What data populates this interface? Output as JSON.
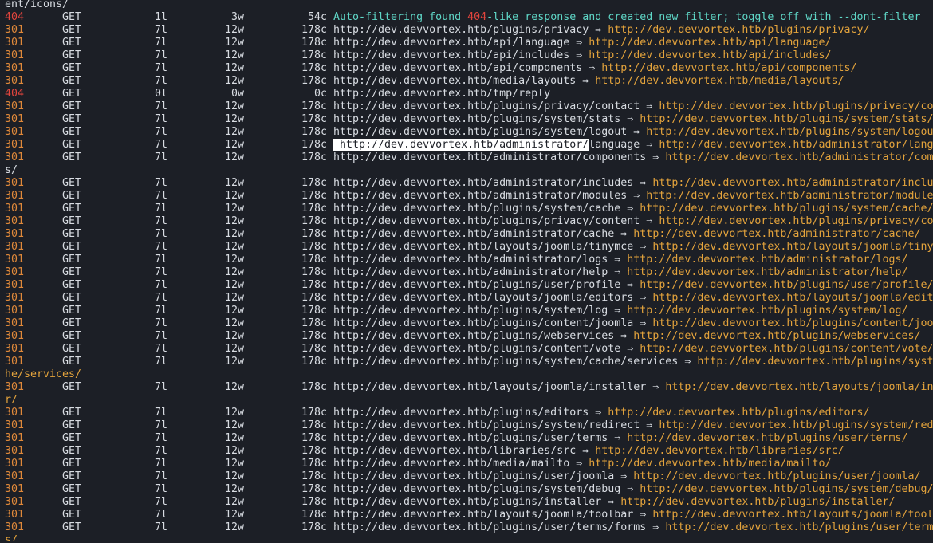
{
  "terminal": {
    "arrow": "⇒",
    "lines": [
      {
        "wrap": "ent/icons/"
      },
      {
        "status": "404",
        "method": "GET",
        "lines": "1l",
        "words": "3w",
        "chars": "54c",
        "msg1": "Auto-filtering found ",
        "msg2": "404",
        "msg3": "-like response and created new filter; toggle off with ",
        "msg4": "--dont-filter"
      },
      {
        "status": "301",
        "method": "GET",
        "lines": "7l",
        "words": "12w",
        "chars": "178c",
        "url": "http://dev.devvortex.htb/plugins/privacy",
        "redirect": "http://dev.devvortex.htb/plugins/privacy/"
      },
      {
        "status": "301",
        "method": "GET",
        "lines": "7l",
        "words": "12w",
        "chars": "178c",
        "url": "http://dev.devvortex.htb/api/language",
        "redirect": "http://dev.devvortex.htb/api/language/"
      },
      {
        "status": "301",
        "method": "GET",
        "lines": "7l",
        "words": "12w",
        "chars": "178c",
        "url": "http://dev.devvortex.htb/api/includes",
        "redirect": "http://dev.devvortex.htb/api/includes/"
      },
      {
        "status": "301",
        "method": "GET",
        "lines": "7l",
        "words": "12w",
        "chars": "178c",
        "url": "http://dev.devvortex.htb/api/components",
        "redirect": "http://dev.devvortex.htb/api/components/"
      },
      {
        "status": "301",
        "method": "GET",
        "lines": "7l",
        "words": "12w",
        "chars": "178c",
        "url": "http://dev.devvortex.htb/media/layouts",
        "redirect": "http://dev.devvortex.htb/media/layouts/"
      },
      {
        "status": "404",
        "method": "GET",
        "lines": "0l",
        "words": "0w",
        "chars": "0c",
        "url": "http://dev.devvortex.htb/tmp/reply"
      },
      {
        "status": "301",
        "method": "GET",
        "lines": "7l",
        "words": "12w",
        "chars": "178c",
        "url": "http://dev.devvortex.htb/plugins/privacy/contact",
        "redirect": "http://dev.devvortex.htb/plugins/privacy/contact/"
      },
      {
        "status": "301",
        "method": "GET",
        "lines": "7l",
        "words": "12w",
        "chars": "178c",
        "url": "http://dev.devvortex.htb/plugins/system/stats",
        "redirect": "http://dev.devvortex.htb/plugins/system/stats/"
      },
      {
        "status": "301",
        "method": "GET",
        "lines": "7l",
        "words": "12w",
        "chars": "178c",
        "url": "http://dev.devvortex.htb/plugins/system/logout",
        "redirect": "http://dev.devvortex.htb/plugins/system/logout/"
      },
      {
        "status": "301",
        "method": "GET",
        "lines": "7l",
        "words": "12w",
        "chars": "178c",
        "url_hl": " http://dev.devvortex.htb/administrator/",
        "url_rest": "language",
        "redirect": "http://dev.devvortex.htb/administrator/language/"
      },
      {
        "status": "301",
        "method": "GET",
        "lines": "7l",
        "words": "12w",
        "chars": "178c",
        "url": "http://dev.devvortex.htb/administrator/components",
        "redirect": "http://dev.devvortex.htb/administrator/component"
      },
      {
        "wrap": "s/"
      },
      {
        "status": "301",
        "method": "GET",
        "lines": "7l",
        "words": "12w",
        "chars": "178c",
        "url": "http://dev.devvortex.htb/administrator/includes",
        "redirect": "http://dev.devvortex.htb/administrator/includes/"
      },
      {
        "status": "301",
        "method": "GET",
        "lines": "7l",
        "words": "12w",
        "chars": "178c",
        "url": "http://dev.devvortex.htb/administrator/modules",
        "redirect": "http://dev.devvortex.htb/administrator/modules/"
      },
      {
        "status": "301",
        "method": "GET",
        "lines": "7l",
        "words": "12w",
        "chars": "178c",
        "url": "http://dev.devvortex.htb/plugins/system/cache",
        "redirect": "http://dev.devvortex.htb/plugins/system/cache/"
      },
      {
        "status": "301",
        "method": "GET",
        "lines": "7l",
        "words": "12w",
        "chars": "178c",
        "url": "http://dev.devvortex.htb/plugins/privacy/content",
        "redirect": "http://dev.devvortex.htb/plugins/privacy/content/"
      },
      {
        "status": "301",
        "method": "GET",
        "lines": "7l",
        "words": "12w",
        "chars": "178c",
        "url": "http://dev.devvortex.htb/administrator/cache",
        "redirect": "http://dev.devvortex.htb/administrator/cache/"
      },
      {
        "status": "301",
        "method": "GET",
        "lines": "7l",
        "words": "12w",
        "chars": "178c",
        "url": "http://dev.devvortex.htb/layouts/joomla/tinymce",
        "redirect": "http://dev.devvortex.htb/layouts/joomla/tinymce/"
      },
      {
        "status": "301",
        "method": "GET",
        "lines": "7l",
        "words": "12w",
        "chars": "178c",
        "url": "http://dev.devvortex.htb/administrator/logs",
        "redirect": "http://dev.devvortex.htb/administrator/logs/"
      },
      {
        "status": "301",
        "method": "GET",
        "lines": "7l",
        "words": "12w",
        "chars": "178c",
        "url": "http://dev.devvortex.htb/administrator/help",
        "redirect": "http://dev.devvortex.htb/administrator/help/"
      },
      {
        "status": "301",
        "method": "GET",
        "lines": "7l",
        "words": "12w",
        "chars": "178c",
        "url": "http://dev.devvortex.htb/plugins/user/profile",
        "redirect": "http://dev.devvortex.htb/plugins/user/profile/"
      },
      {
        "status": "301",
        "method": "GET",
        "lines": "7l",
        "words": "12w",
        "chars": "178c",
        "url": "http://dev.devvortex.htb/layouts/joomla/editors",
        "redirect": "http://dev.devvortex.htb/layouts/joomla/editors/"
      },
      {
        "status": "301",
        "method": "GET",
        "lines": "7l",
        "words": "12w",
        "chars": "178c",
        "url": "http://dev.devvortex.htb/plugins/system/log",
        "redirect": "http://dev.devvortex.htb/plugins/system/log/"
      },
      {
        "status": "301",
        "method": "GET",
        "lines": "7l",
        "words": "12w",
        "chars": "178c",
        "url": "http://dev.devvortex.htb/plugins/content/joomla",
        "redirect": "http://dev.devvortex.htb/plugins/content/joomla/"
      },
      {
        "status": "301",
        "method": "GET",
        "lines": "7l",
        "words": "12w",
        "chars": "178c",
        "url": "http://dev.devvortex.htb/plugins/webservices",
        "redirect": "http://dev.devvortex.htb/plugins/webservices/"
      },
      {
        "status": "301",
        "method": "GET",
        "lines": "7l",
        "words": "12w",
        "chars": "178c",
        "url": "http://dev.devvortex.htb/plugins/content/vote",
        "redirect": "http://dev.devvortex.htb/plugins/content/vote/"
      },
      {
        "status": "301",
        "method": "GET",
        "lines": "7l",
        "words": "12w",
        "chars": "178c",
        "url": "http://dev.devvortex.htb/plugins/system/cache/services",
        "redirect": "http://dev.devvortex.htb/plugins/system/cac"
      },
      {
        "wrap_url": "he/services/"
      },
      {
        "status": "301",
        "method": "GET",
        "lines": "7l",
        "words": "12w",
        "chars": "178c",
        "url": "http://dev.devvortex.htb/layouts/joomla/installer",
        "redirect": "http://dev.devvortex.htb/layouts/joomla/installe"
      },
      {
        "wrap_url": "r/"
      },
      {
        "status": "301",
        "method": "GET",
        "lines": "7l",
        "words": "12w",
        "chars": "178c",
        "url": "http://dev.devvortex.htb/plugins/editors",
        "redirect": "http://dev.devvortex.htb/plugins/editors/"
      },
      {
        "status": "301",
        "method": "GET",
        "lines": "7l",
        "words": "12w",
        "chars": "178c",
        "url": "http://dev.devvortex.htb/plugins/system/redirect",
        "redirect": "http://dev.devvortex.htb/plugins/system/redirect/"
      },
      {
        "status": "301",
        "method": "GET",
        "lines": "7l",
        "words": "12w",
        "chars": "178c",
        "url": "http://dev.devvortex.htb/plugins/user/terms",
        "redirect": "http://dev.devvortex.htb/plugins/user/terms/"
      },
      {
        "status": "301",
        "method": "GET",
        "lines": "7l",
        "words": "12w",
        "chars": "178c",
        "url": "http://dev.devvortex.htb/libraries/src",
        "redirect": "http://dev.devvortex.htb/libraries/src/"
      },
      {
        "status": "301",
        "method": "GET",
        "lines": "7l",
        "words": "12w",
        "chars": "178c",
        "url": "http://dev.devvortex.htb/media/mailto",
        "redirect": "http://dev.devvortex.htb/media/mailto/"
      },
      {
        "status": "301",
        "method": "GET",
        "lines": "7l",
        "words": "12w",
        "chars": "178c",
        "url": "http://dev.devvortex.htb/plugins/user/joomla",
        "redirect": "http://dev.devvortex.htb/plugins/user/joomla/"
      },
      {
        "status": "301",
        "method": "GET",
        "lines": "7l",
        "words": "12w",
        "chars": "178c",
        "url": "http://dev.devvortex.htb/plugins/system/debug",
        "redirect": "http://dev.devvortex.htb/plugins/system/debug/"
      },
      {
        "status": "301",
        "method": "GET",
        "lines": "7l",
        "words": "12w",
        "chars": "178c",
        "url": "http://dev.devvortex.htb/plugins/installer",
        "redirect": "http://dev.devvortex.htb/plugins/installer/"
      },
      {
        "status": "301",
        "method": "GET",
        "lines": "7l",
        "words": "12w",
        "chars": "178c",
        "url": "http://dev.devvortex.htb/layouts/joomla/toolbar",
        "redirect": "http://dev.devvortex.htb/layouts/joomla/toolbar/"
      },
      {
        "status": "301",
        "method": "GET",
        "lines": "7l",
        "words": "12w",
        "chars": "178c",
        "url": "http://dev.devvortex.htb/plugins/user/terms/forms",
        "redirect": "http://dev.devvortex.htb/plugins/user/terms/form"
      },
      {
        "wrap_url": "s/"
      }
    ]
  },
  "colors": {
    "background": "#1c1f26",
    "foreground": "#d8dce2",
    "status_301": "#e0893a",
    "status_404": "#e2453d",
    "info_cyan": "#5fd7c7",
    "redirect_url": "#e3a33c",
    "selection_bg": "#ffffff"
  }
}
